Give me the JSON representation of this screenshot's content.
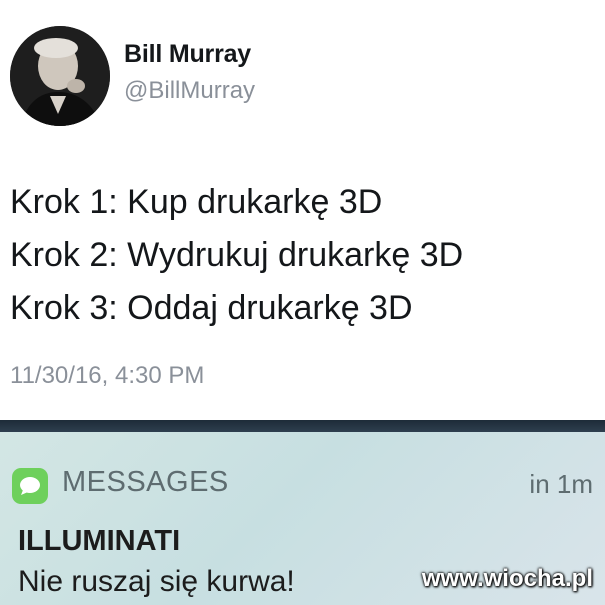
{
  "tweet": {
    "author_name": "Bill Murray",
    "author_handle": "@BillMurray",
    "lines": [
      "Krok 1: Kup drukarkę 3D",
      "Krok 2: Wydrukuj drukarkę 3D",
      "Krok 3: Oddaj drukarkę 3D"
    ],
    "timestamp": "11/30/16, 4:30 PM"
  },
  "notification": {
    "app_icon": "messages-bubble-icon",
    "app_name": "MESSAGES",
    "time": "in 1m",
    "title": "ILLUMINATI",
    "body": "Nie ruszaj się kurwa!",
    "accent_color": "#6ed05c"
  },
  "watermark": "www.wiocha.pl"
}
